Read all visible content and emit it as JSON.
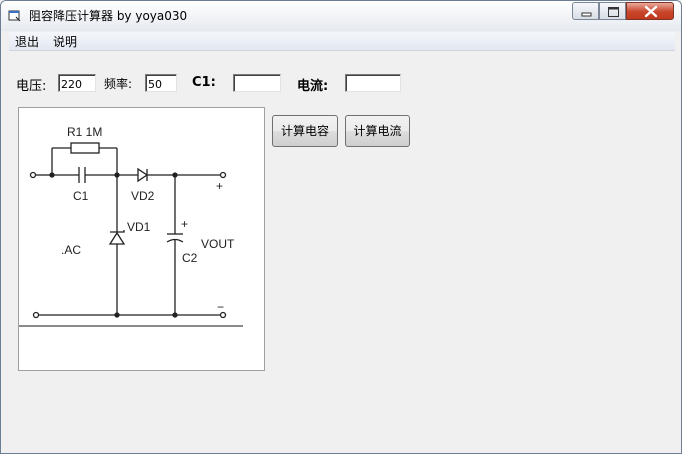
{
  "window": {
    "title": "阻容降压计算器 by yoya030"
  },
  "menu": {
    "items": [
      {
        "label": "退出"
      },
      {
        "label": "说明"
      }
    ]
  },
  "form": {
    "voltage_label": "电压:",
    "voltage_value": "220",
    "frequency_label": "频率:",
    "frequency_value": "50",
    "c1_label": "C1:",
    "c1_value": "",
    "current_label": "电流:",
    "current_value": ""
  },
  "buttons": {
    "calc_capacitance": "计算电容",
    "calc_current": "计算电流"
  },
  "circuit": {
    "r1_label": "R1 1M",
    "c1_label": "C1",
    "vd2_label": "VD2",
    "vd1_label": "VD1",
    "c2_label": "C2",
    "vout_label": "VOUT",
    "ac_label": ".AC",
    "plus_top": "+",
    "minus_bottom": "−",
    "c2_plus": "+"
  }
}
